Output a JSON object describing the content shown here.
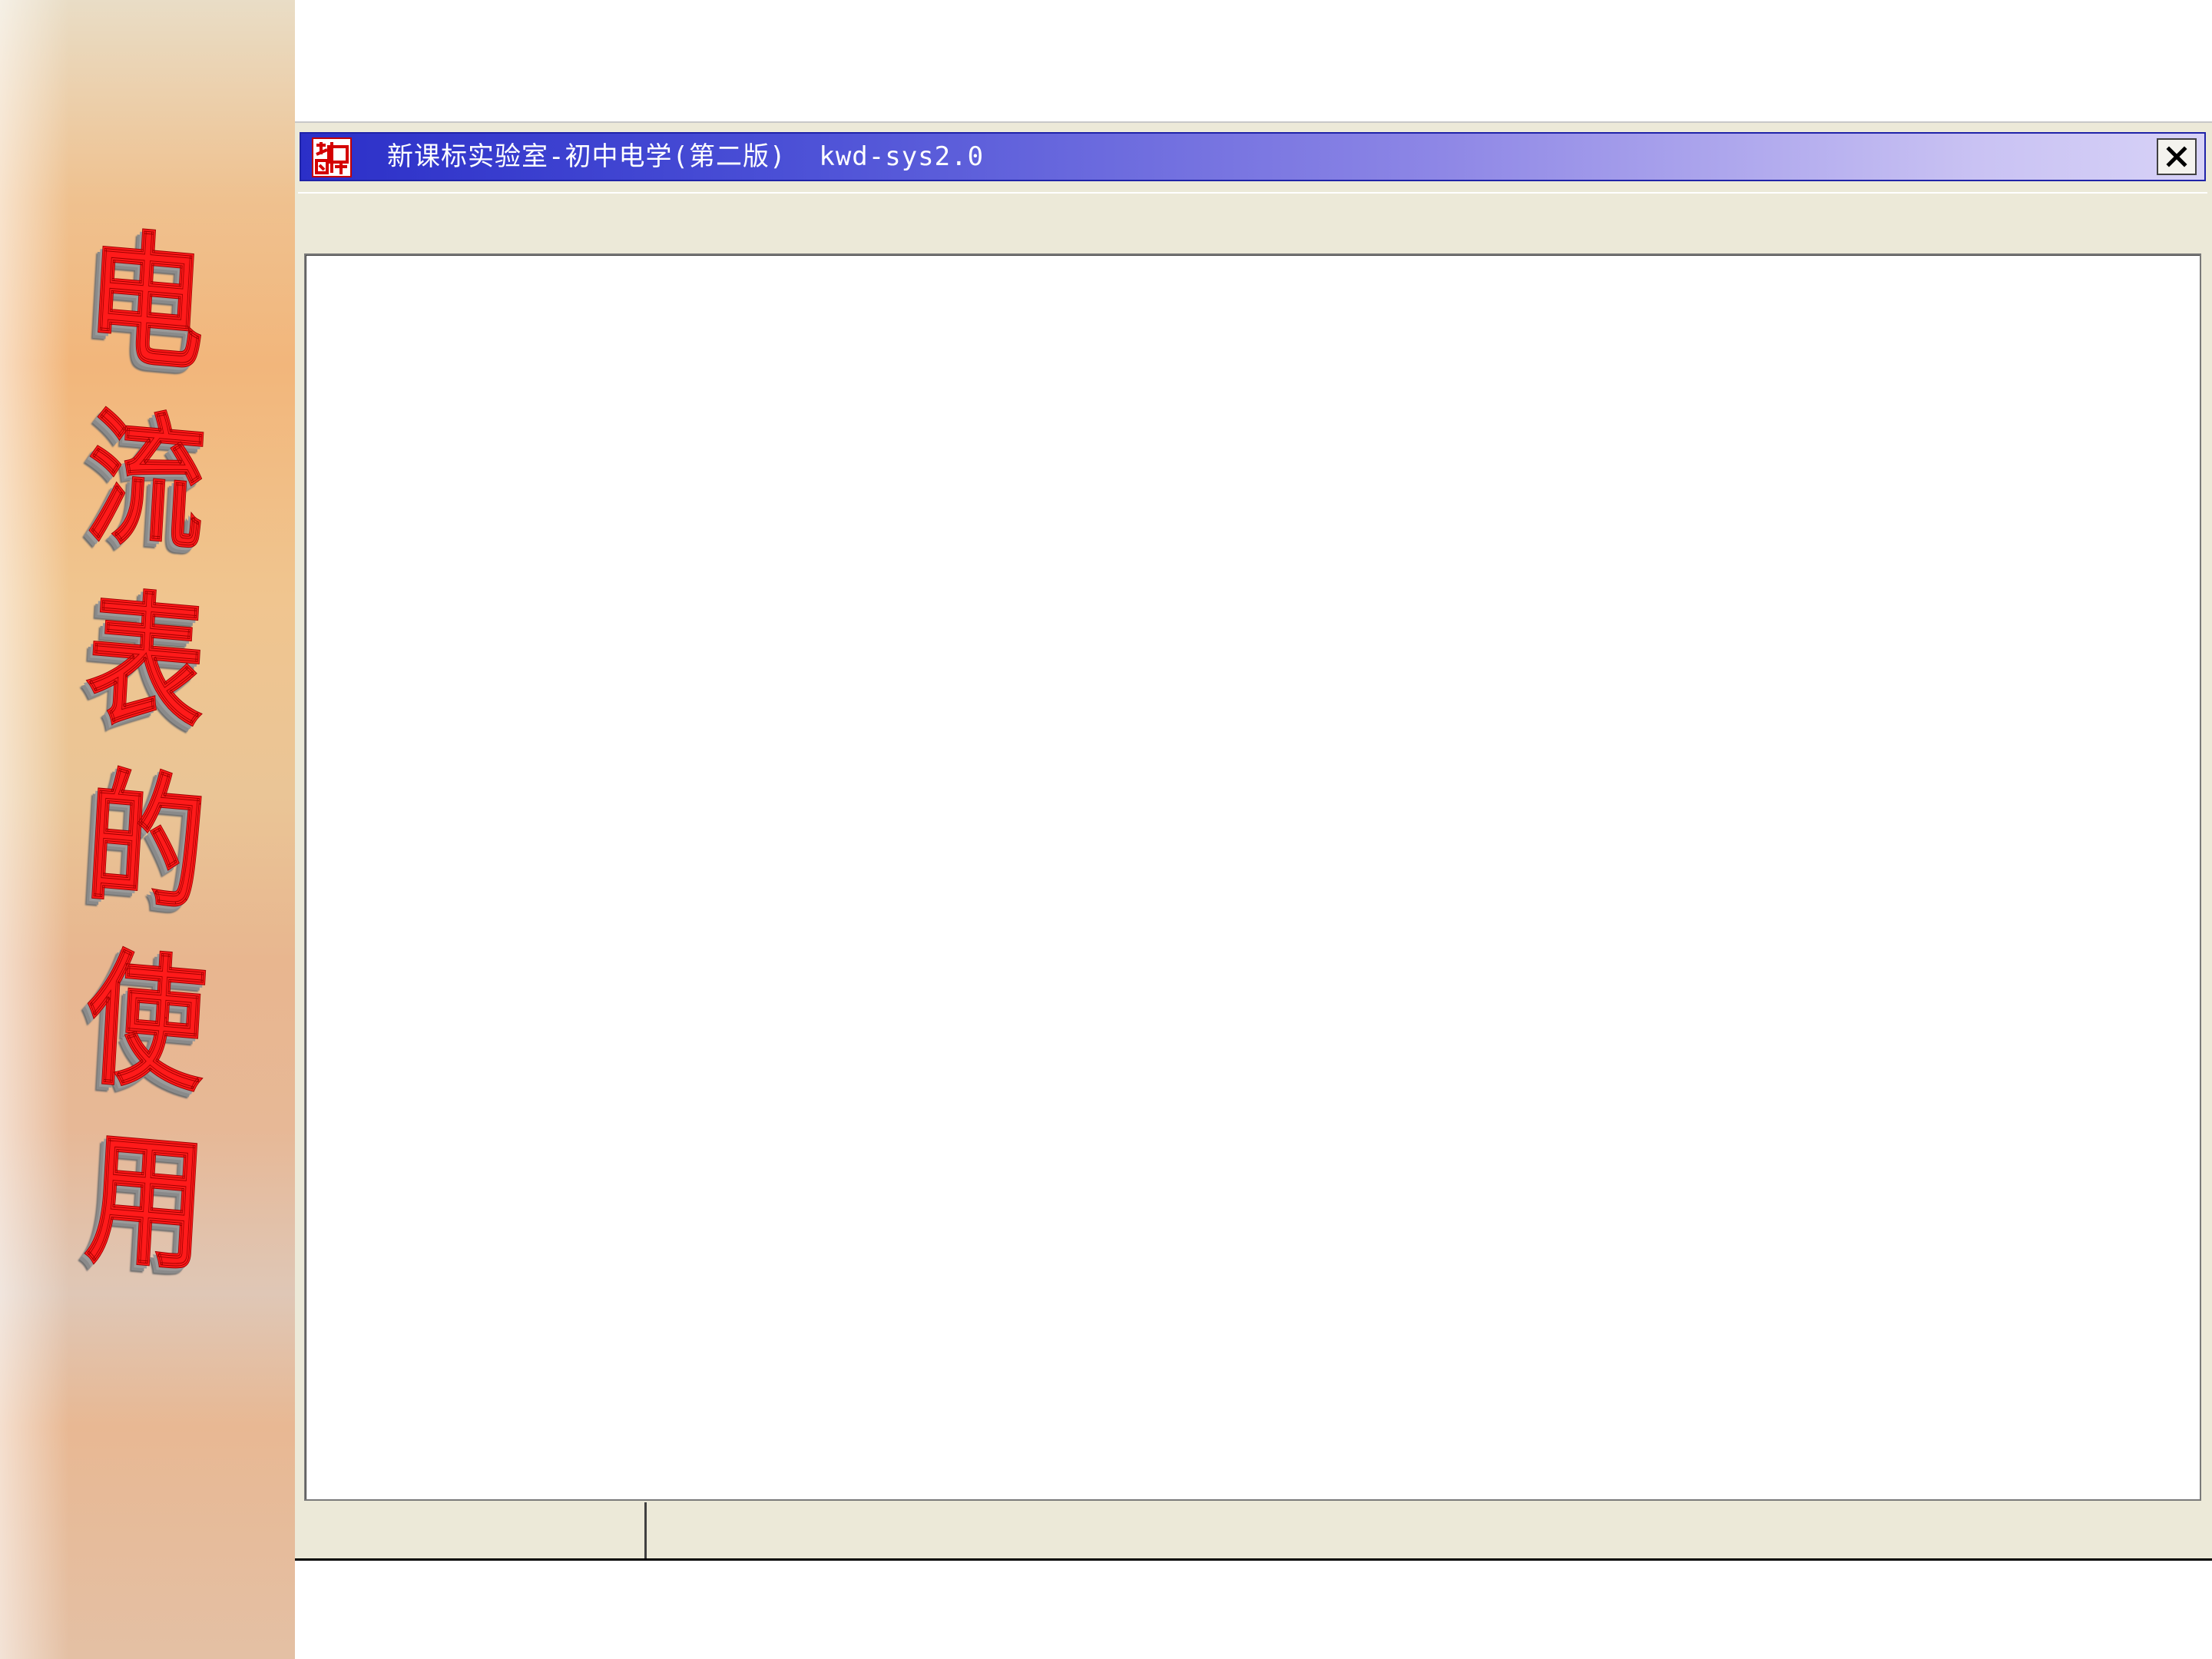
{
  "side_panel": {
    "title_chars": [
      "电",
      "流",
      "表",
      "的",
      "使",
      "用"
    ]
  },
  "window": {
    "title": "新课标实验室-初中电学(第二版)  kwd-sys2.0",
    "close_glyph": "✕",
    "logo_icon": "app-logo-icon"
  },
  "status_bar": {
    "cell_1": "",
    "cell_2": ""
  },
  "colors": {
    "title_bar_start": "#2b2fc8",
    "title_bar_end": "#d7d2f7",
    "window_face": "#ece9d8",
    "side_title_red": "#ff1a1a"
  }
}
